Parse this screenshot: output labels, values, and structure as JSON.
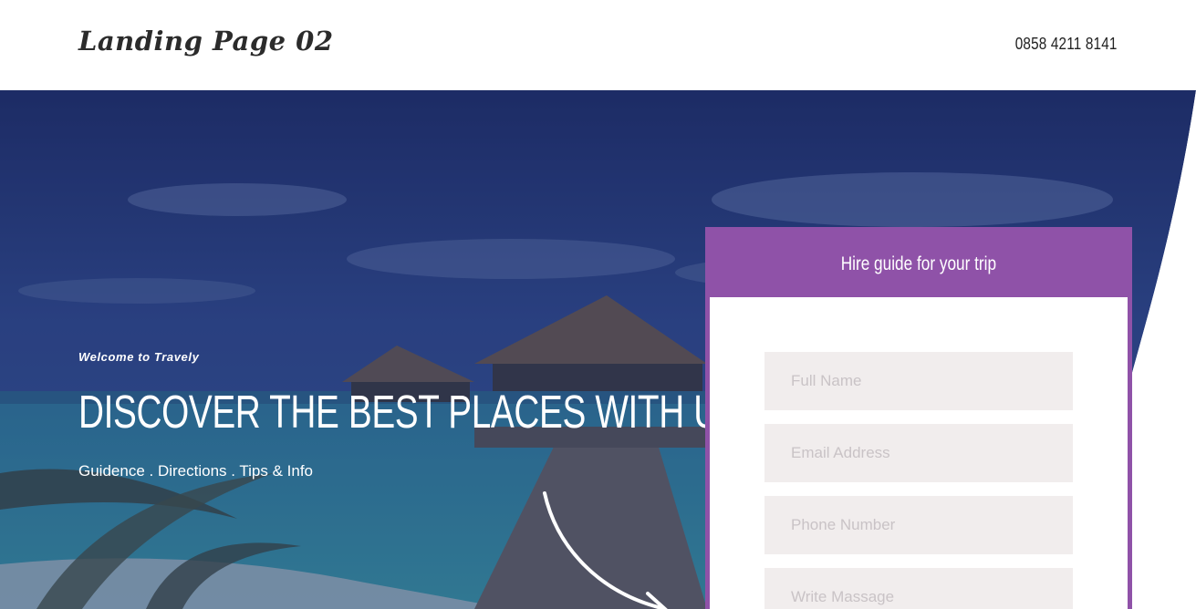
{
  "header": {
    "logo": "Landing Page 02",
    "phone": "0858 4211 8141"
  },
  "hero": {
    "welcome": "Welcome to Travely",
    "headline": "DISCOVER THE BEST PLACES WITH US",
    "tagline": "Guidence . Directions . Tips & Info"
  },
  "form": {
    "title": "Hire guide for your trip",
    "full_name_placeholder": "Full Name",
    "email_placeholder": "Email Address",
    "phone_placeholder": "Phone Number",
    "message_placeholder": "Write Massage"
  },
  "colors": {
    "accent": "#8f52a8",
    "overlay": "#1f2f6a",
    "field_bg": "#f1eded"
  },
  "icons": {
    "arrow": "curved-arrow-icon"
  }
}
